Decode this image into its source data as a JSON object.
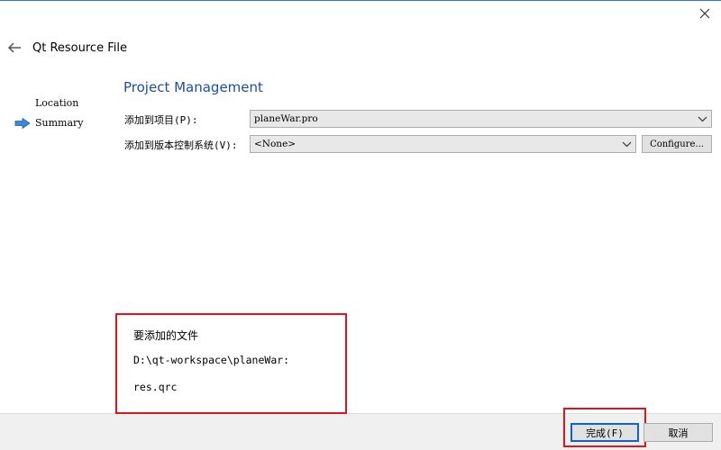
{
  "window": {
    "wizard_title": "Qt Resource File",
    "back_icon": "back-arrow-icon",
    "close_icon": "close-icon"
  },
  "steps": [
    {
      "label": "Location",
      "current": false
    },
    {
      "label": "Summary",
      "current": true
    }
  ],
  "section": {
    "title": "Project Management"
  },
  "form": {
    "add_to_project": {
      "label": "添加到项目(P):",
      "value": "planeWar.pro"
    },
    "add_to_vcs": {
      "label": "添加到版本控制系统(V):",
      "value": "<None>"
    },
    "configure_label": "Configure..."
  },
  "files": {
    "heading": "要添加的文件",
    "path": "D:\\qt-workspace\\planeWar:",
    "name": "res.qrc"
  },
  "footer": {
    "finish_label": "完成(F)",
    "cancel_label": "取消"
  },
  "colors": {
    "accent": "#1c4fa0",
    "highlight": "#e0141e",
    "step_arrow": "#3d86d6",
    "default_button_border": "#0a64d8"
  }
}
